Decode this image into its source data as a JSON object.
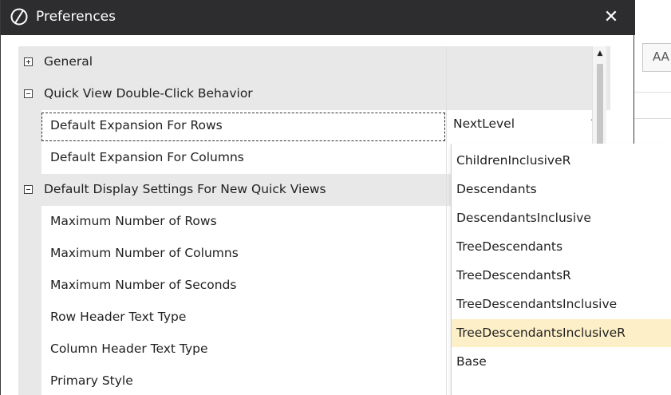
{
  "dialog": {
    "title": "Preferences",
    "close_glyph": "✕"
  },
  "background": {
    "tab_label": "AA"
  },
  "grid": {
    "rows": [
      {
        "type": "category",
        "label": "General",
        "expanded": false
      },
      {
        "type": "category",
        "label": "Quick View Double-Click Behavior",
        "expanded": true
      },
      {
        "type": "property",
        "label": "Default Expansion For Rows",
        "value": "NextLevel",
        "selected": true
      },
      {
        "type": "property",
        "label": "Default Expansion For Columns",
        "value": ""
      },
      {
        "type": "category",
        "label": "Default Display Settings For New Quick Views",
        "expanded": true
      },
      {
        "type": "property",
        "label": "Maximum Number of Rows",
        "value": ""
      },
      {
        "type": "property",
        "label": "Maximum Number of Columns",
        "value": ""
      },
      {
        "type": "property",
        "label": "Maximum Number of Seconds",
        "value": ""
      },
      {
        "type": "property",
        "label": "Row Header Text Type",
        "value": ""
      },
      {
        "type": "property",
        "label": "Column Header Text Type",
        "value": ""
      },
      {
        "type": "property",
        "label": "Primary Style",
        "value": ""
      }
    ]
  },
  "dropdown": {
    "selected_value": "NextLevel",
    "highlighted": "TreeDescendantsInclusiveR",
    "options": [
      "ChildrenInclusiveR",
      "Descendants",
      "DescendantsInclusive",
      "TreeDescendants",
      "TreeDescendantsR",
      "TreeDescendantsInclusive",
      "TreeDescendantsInclusiveR",
      "Base"
    ]
  },
  "icons": {
    "logo": "app-logo-icon",
    "close": "close-icon",
    "expand": "plus-box-icon",
    "collapse": "minus-box-icon",
    "dropdown_arrow": "triangle-down-icon",
    "scroll_up": "triangle-up-icon"
  },
  "colors": {
    "titlebar": "#2d2d30",
    "category_bg": "#e8e8e8",
    "highlight": "#fdefc7"
  }
}
